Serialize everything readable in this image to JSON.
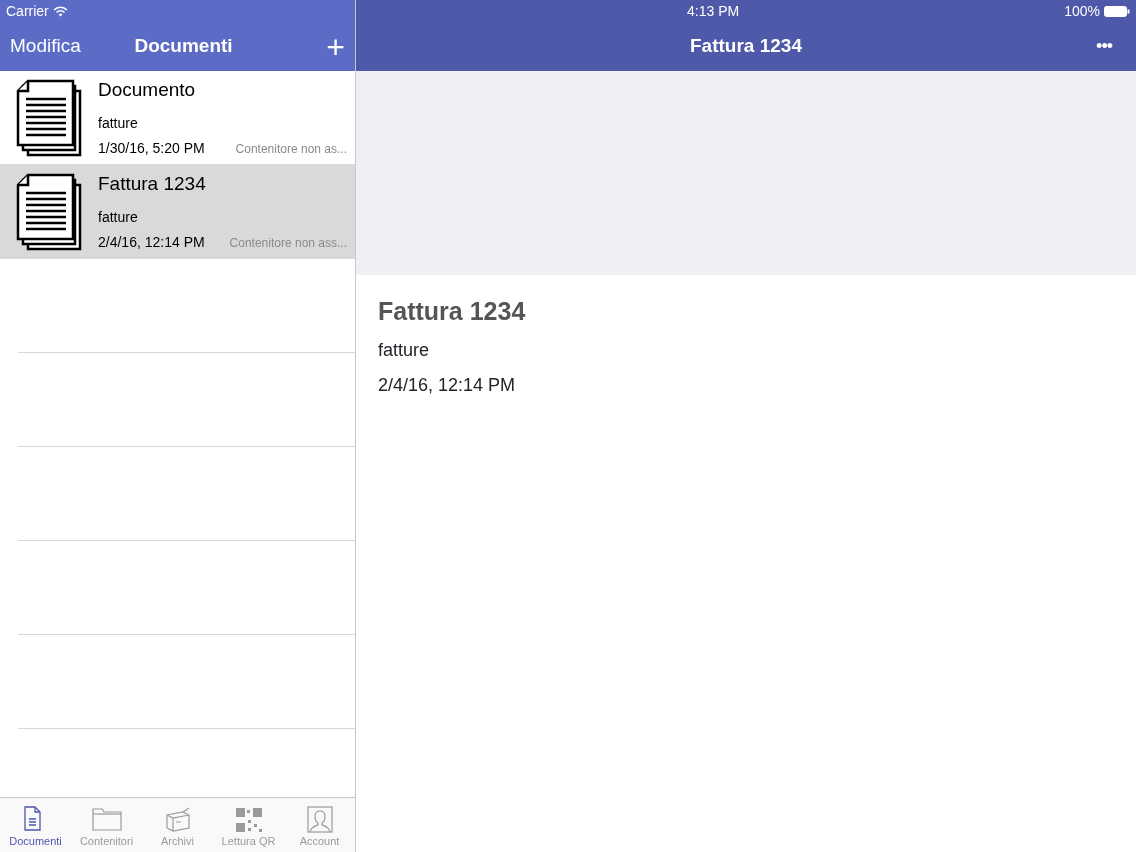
{
  "status_bar": {
    "carrier": "Carrier",
    "time": "4:13 PM",
    "battery": "100%"
  },
  "master": {
    "edit_button": "Modifica",
    "title": "Documenti",
    "add_button": "+"
  },
  "documents": [
    {
      "title": "Documento",
      "folder": "fatture",
      "date": "1/30/16, 5:20 PM",
      "container": "Contenitore non as...",
      "selected": false
    },
    {
      "title": "Fattura 1234",
      "folder": "fatture",
      "date": "2/4/16, 12:14 PM",
      "container": "Contenitore non ass...",
      "selected": true
    }
  ],
  "tab_bar": [
    {
      "label": "Documenti",
      "kind": "document",
      "selected": true
    },
    {
      "label": "Contenitori",
      "kind": "folder",
      "selected": false
    },
    {
      "label": "Archivi",
      "kind": "box",
      "selected": false
    },
    {
      "label": "Lettura QR",
      "kind": "qr",
      "selected": false
    },
    {
      "label": "Account",
      "kind": "account",
      "selected": false
    }
  ],
  "detail": {
    "nav_title": "Fattura 1234",
    "more_button": "•••",
    "title": "Fattura 1234",
    "folder": "fatture",
    "date": "2/4/16, 12:14 PM"
  }
}
